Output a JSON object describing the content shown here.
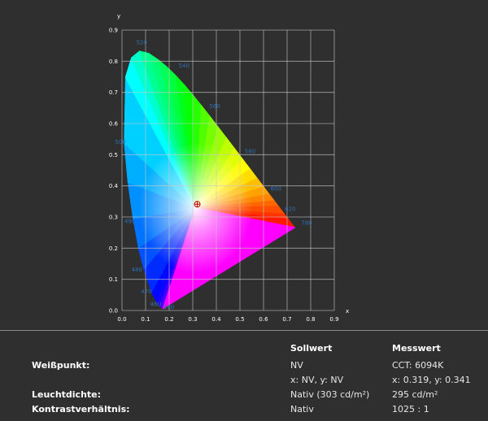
{
  "chart_data": {
    "type": "chromaticity-diagram",
    "xlabel": "x",
    "ylabel": "y",
    "xlim": [
      0.0,
      0.9
    ],
    "ylim": [
      0.0,
      0.9
    ],
    "x_ticks": [
      "0.0",
      "0.1",
      "0.2",
      "0.3",
      "0.4",
      "0.5",
      "0.6",
      "0.7",
      "0.8",
      "0.9"
    ],
    "y_ticks": [
      "0.0",
      "0.1",
      "0.2",
      "0.3",
      "0.4",
      "0.5",
      "0.6",
      "0.7",
      "0.8",
      "0.9"
    ],
    "grid": true,
    "wavelength_labels": [
      {
        "text": "380",
        "x": 0.175,
        "y": 0.005
      },
      {
        "text": "460",
        "x": 0.12,
        "y": 0.015
      },
      {
        "text": "470",
        "x": 0.08,
        "y": 0.055
      },
      {
        "text": "480",
        "x": 0.04,
        "y": 0.125
      },
      {
        "text": "490",
        "x": 0.01,
        "y": 0.28
      },
      {
        "text": "500",
        "x": -0.03,
        "y": 0.535
      },
      {
        "text": "520",
        "x": 0.06,
        "y": 0.855
      },
      {
        "text": "540",
        "x": 0.24,
        "y": 0.78
      },
      {
        "text": "560",
        "x": 0.37,
        "y": 0.65
      },
      {
        "text": "580",
        "x": 0.52,
        "y": 0.505
      },
      {
        "text": "600",
        "x": 0.63,
        "y": 0.385
      },
      {
        "text": "620",
        "x": 0.69,
        "y": 0.32
      },
      {
        "text": "780",
        "x": 0.76,
        "y": 0.275
      }
    ],
    "locus": [
      [
        0.1741,
        0.005
      ],
      [
        0.1714,
        0.0051
      ],
      [
        0.1689,
        0.0069
      ],
      [
        0.1644,
        0.0109
      ],
      [
        0.1566,
        0.0177
      ],
      [
        0.144,
        0.0297
      ],
      [
        0.1241,
        0.0578
      ],
      [
        0.0913,
        0.1327
      ],
      [
        0.0687,
        0.2007
      ],
      [
        0.0454,
        0.295
      ],
      [
        0.0235,
        0.4127
      ],
      [
        0.0082,
        0.5384
      ],
      [
        0.0139,
        0.7502
      ],
      [
        0.0389,
        0.812
      ],
      [
        0.0743,
        0.8338
      ],
      [
        0.1142,
        0.8262
      ],
      [
        0.1547,
        0.8059
      ],
      [
        0.1929,
        0.7816
      ],
      [
        0.2296,
        0.7543
      ],
      [
        0.2658,
        0.7243
      ],
      [
        0.3016,
        0.6923
      ],
      [
        0.3373,
        0.6589
      ],
      [
        0.3731,
        0.6245
      ],
      [
        0.4087,
        0.5896
      ],
      [
        0.4441,
        0.5547
      ],
      [
        0.4788,
        0.5202
      ],
      [
        0.5125,
        0.4866
      ],
      [
        0.5448,
        0.4544
      ],
      [
        0.5752,
        0.4242
      ],
      [
        0.6029,
        0.3965
      ],
      [
        0.627,
        0.3725
      ],
      [
        0.6482,
        0.3514
      ],
      [
        0.6658,
        0.334
      ],
      [
        0.6915,
        0.3083
      ],
      [
        0.7079,
        0.292
      ],
      [
        0.7347,
        0.2653
      ]
    ],
    "whitepoint_marker": {
      "x": 0.319,
      "y": 0.341
    }
  },
  "table": {
    "headers": {
      "sollwert": "Sollwert",
      "messwert": "Messwert"
    },
    "rows": [
      {
        "label": "Weißpunkt:",
        "soll": "NV",
        "mess": "CCT: 6094K"
      },
      {
        "label": "",
        "soll": "x: NV, y: NV",
        "mess": "x: 0.319, y: 0.341"
      },
      {
        "label": "Leuchtdichte:",
        "soll": "Nativ (303 cd/m²)",
        "mess": "295 cd/m²"
      },
      {
        "label": "Kontrastverhältnis:",
        "soll": "Nativ",
        "mess": "1025 : 1"
      }
    ]
  },
  "colors": {
    "background": "#2f2f2f",
    "grid": "#c8c8c8",
    "wavelength_label": "#2f6fb0",
    "marker": "#c00000"
  }
}
